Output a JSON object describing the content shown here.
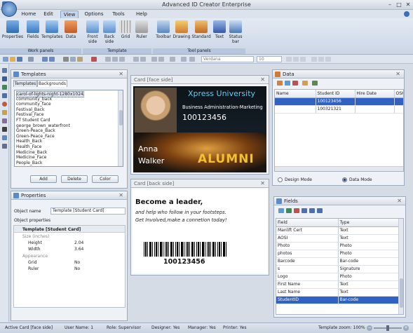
{
  "app": {
    "title": "Advanced ID Creator Enterprise"
  },
  "menu": [
    "Home",
    "Edit",
    "View",
    "Options",
    "Tools",
    "Help"
  ],
  "ribbon": {
    "buttons": [
      "Properties",
      "Fields",
      "Templates",
      "Data",
      "Front side",
      "Back side",
      "Grid",
      "Ruler",
      "Toolbar",
      "Drawing",
      "Standard",
      "Text",
      "Status bar"
    ],
    "groups": [
      "Work panels",
      "Template",
      "Tool panels"
    ]
  },
  "toolbar": {
    "font": "Verdana",
    "size": "10"
  },
  "templates_panel": {
    "title": "Templates",
    "tabs": [
      "Templates",
      "Backgrounds"
    ],
    "items": [
      "carol-of-lights-night-1280x1024",
      "community_back",
      "community_face",
      "Festival_Back",
      "Festival_Face",
      "FT Student Card",
      "george_brown_waterfront",
      "Green-Peace_Back",
      "Green-Peace_Face",
      "Health_Back",
      "Health_Face",
      "Medicine_Back",
      "Medicine_Face",
      "People_Back"
    ],
    "buttons": [
      "Add",
      "Delete",
      "Color"
    ]
  },
  "properties_panel": {
    "title": "Properties",
    "object_name_label": "Object name",
    "object_name_value": "Template [Student Card]",
    "object_properties_label": "Object properties",
    "section": "Template [Student Card]",
    "size_label": "Size (inches)",
    "height_label": "Height",
    "height_value": "2.04",
    "width_label": "Width",
    "width_value": "3.64",
    "appearance_label": "Appearance",
    "grid_label": "Grid",
    "grid_value": "No",
    "ruler_label": "Ruler",
    "ruler_value": "No"
  },
  "card_face": {
    "title": "Card [face side]",
    "university": "Xpress University",
    "department": "Business Administration-Marketing",
    "id": "100123456",
    "first_name": "Anna",
    "last_name": "Walker",
    "badge": "ALUMNI"
  },
  "card_back": {
    "title": "Card [back side]",
    "headline": "Become a leader,",
    "line1": "and help who follow in your footsteps.",
    "line2": "Get Involved,make a connetion today!",
    "barcode_number": "100123456"
  },
  "data_panel": {
    "title": "Data",
    "columns": [
      "Name",
      "Student ID",
      "Hire Date",
      "OSH"
    ],
    "rows": [
      [
        "",
        "100123456",
        "",
        ""
      ],
      [
        "",
        "100321321",
        "",
        ""
      ]
    ],
    "design_mode": "Design Mode",
    "data_mode": "Data Mode"
  },
  "fields_panel": {
    "title": "Fields",
    "columns": [
      "Field",
      "Type"
    ],
    "rows": [
      [
        "Manlift Cert",
        "Text"
      ],
      [
        "AOSI",
        "Text"
      ],
      [
        "Photo",
        "Photo"
      ],
      [
        "photos",
        "Photo"
      ],
      [
        "Barcode",
        "Bar-code"
      ],
      [
        "s",
        "Signature"
      ],
      [
        "Logo",
        "Photo"
      ],
      [
        "First Name",
        "Text"
      ],
      [
        "Last Name",
        "Text"
      ],
      [
        "StudentID",
        "Bar-code"
      ]
    ]
  },
  "status": {
    "active_card": "Active Card [face side]",
    "user": "User Name:  1",
    "role": "Role:  Supervisor",
    "designer": "Designer:  Yes",
    "manager": "Manager: Yes",
    "printer": "Printer:  Yes",
    "zoom": "Template zoom: 100%"
  },
  "colors": {
    "accent": "#2f62c2",
    "card_dark": "#121a22",
    "uni_text": "#5fd0f0",
    "alumni": "#f2c12e"
  }
}
